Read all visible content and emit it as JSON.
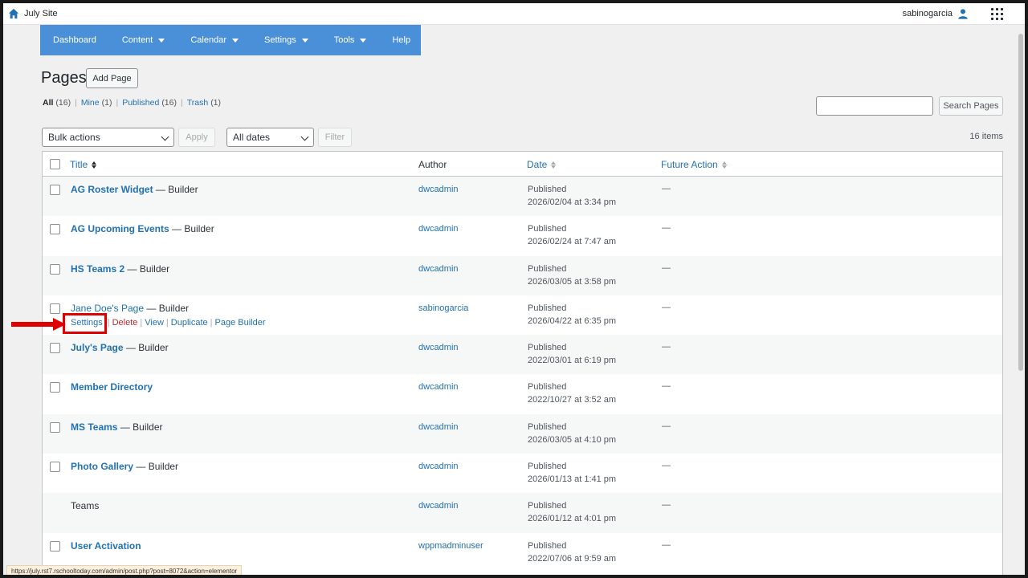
{
  "topbar": {
    "site_name": "July Site",
    "username": "sabinogarcia"
  },
  "nav": {
    "items": [
      {
        "label": "Dashboard",
        "dropdown": false
      },
      {
        "label": "Content",
        "dropdown": true
      },
      {
        "label": "Calendar",
        "dropdown": true
      },
      {
        "label": "Settings",
        "dropdown": true
      },
      {
        "label": "Tools",
        "dropdown": true
      },
      {
        "label": "Help",
        "dropdown": false
      }
    ]
  },
  "page": {
    "title": "Pages",
    "add_button": "Add Page"
  },
  "views": {
    "all": {
      "label": "All",
      "count": "(16)"
    },
    "mine": {
      "label": "Mine",
      "count": "(1)"
    },
    "published": {
      "label": "Published",
      "count": "(16)"
    },
    "trash": {
      "label": "Trash",
      "count": "(1)"
    }
  },
  "search": {
    "button": "Search Pages",
    "value": ""
  },
  "toolbar": {
    "bulk_selected": "Bulk actions",
    "apply": "Apply",
    "dates_selected": "All dates",
    "filter": "Filter",
    "items_count": "16 items"
  },
  "table": {
    "headers": {
      "title": "Title",
      "author": "Author",
      "date": "Date",
      "future_action": "Future Action"
    },
    "rows": [
      {
        "title": "AG Roster Widget",
        "state": " — Builder",
        "author": "dwcadmin",
        "status": "Published",
        "date": "2026/02/04 at 3:34 pm",
        "future": "—"
      },
      {
        "title": "AG Upcoming Events",
        "state": " — Builder",
        "author": "dwcadmin",
        "status": "Published",
        "date": "2026/02/24 at 7:47 am",
        "future": "—"
      },
      {
        "title": "HS Teams 2",
        "state": " — Builder",
        "author": "dwcadmin",
        "status": "Published",
        "date": "2026/03/05 at 3:58 pm",
        "future": "—"
      },
      {
        "title": "Jane Doe's Page",
        "state": " — Builder",
        "author": "sabinogarcia",
        "status": "Published",
        "date": "2026/04/22 at 6:35 pm",
        "future": "—"
      },
      {
        "title": "July's Page",
        "state": " — Builder",
        "author": "dwcadmin",
        "status": "Published",
        "date": "2022/03/01 at 6:19 pm",
        "future": "—"
      },
      {
        "title": "Member Directory",
        "state": "",
        "author": "dwcadmin",
        "status": "Published",
        "date": "2022/10/27 at 3:52 am",
        "future": "—"
      },
      {
        "title": "MS Teams",
        "state": " — Builder",
        "author": "dwcadmin",
        "status": "Published",
        "date": "2026/03/05 at 4:10 pm",
        "future": "—"
      },
      {
        "title": "Photo Gallery",
        "state": " — Builder",
        "author": "dwcadmin",
        "status": "Published",
        "date": "2026/01/13 at 1:41 pm",
        "future": "—"
      },
      {
        "title": "Teams",
        "state": "",
        "author": "dwcadmin",
        "status": "Published",
        "date": "2026/01/12 at 4:01 pm",
        "future": "—"
      },
      {
        "title": "User Activation",
        "state": "",
        "author": "wppmadminuser",
        "status": "Published",
        "date": "2022/07/06 at 9:59 am",
        "future": "—"
      }
    ],
    "row_actions": {
      "settings": "Settings",
      "delete": "Delete",
      "view": "View",
      "duplicate": "Duplicate",
      "page_builder": "Page Builder"
    }
  },
  "status_url": "https://july.rst7.rschooltoday.com/admin/post.php?post=8072&action=elementor",
  "colors": {
    "nav_bg": "#4a90d9",
    "link": "#2271b1",
    "highlight": "#e00000"
  }
}
